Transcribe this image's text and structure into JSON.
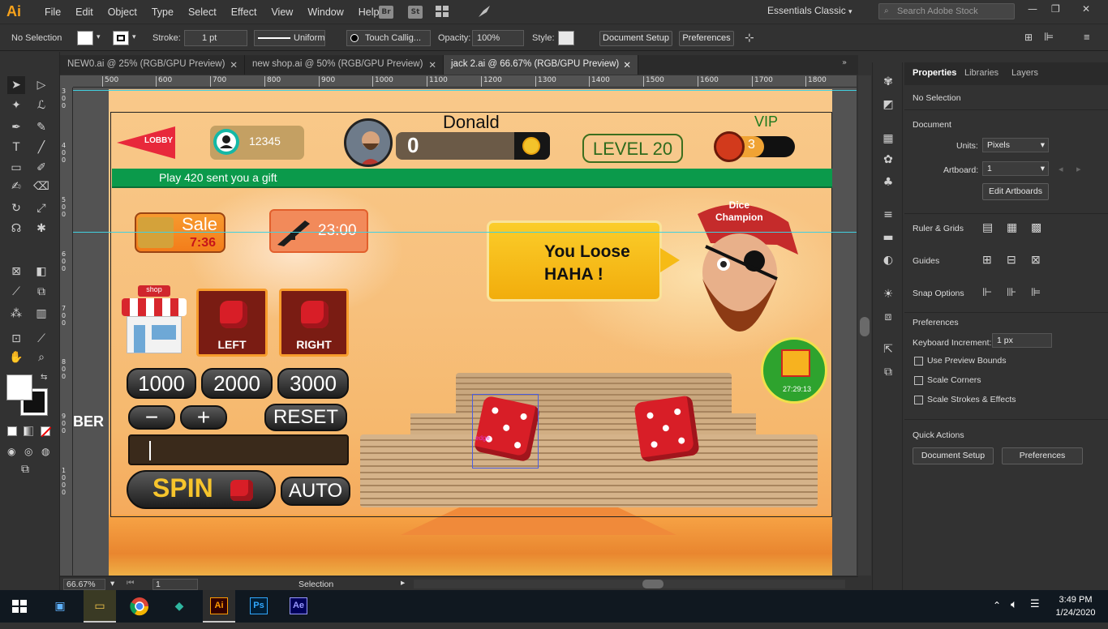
{
  "app": {
    "logo": "Ai",
    "menu": [
      "File",
      "Edit",
      "Object",
      "Type",
      "Select",
      "Effect",
      "View",
      "Window",
      "Help"
    ],
    "bridge_label": "Br",
    "stock_label": "St",
    "workspace": "Essentials Classic",
    "search_placeholder": "Search Adobe Stock"
  },
  "controlbar": {
    "selection_status": "No Selection",
    "stroke_label": "Stroke:",
    "stroke_value": "1 pt",
    "profile": "Uniform",
    "brush": "Touch Callig...",
    "opacity_label": "Opacity:",
    "opacity_value": "100%",
    "style_label": "Style:",
    "document_setup": "Document Setup",
    "preferences": "Preferences"
  },
  "tabs": [
    {
      "label": "NEW0.ai @ 25% (RGB/GPU Preview)",
      "active": false
    },
    {
      "label": "new shop.ai @ 50% (RGB/GPU Preview)",
      "active": false
    },
    {
      "label": "jack 2.ai @ 66.67% (RGB/GPU Preview)",
      "active": true
    }
  ],
  "hruler_marks": [
    "500",
    "600",
    "700",
    "800",
    "900",
    "1000",
    "1100",
    "1200",
    "1300",
    "1400",
    "1500",
    "1600",
    "1700",
    "1800"
  ],
  "vruler_marks": [
    "300",
    "400",
    "500",
    "600",
    "700",
    "800",
    "900",
    "1000"
  ],
  "artboard": {
    "lobby": "LOBBY",
    "player_id": "12345",
    "player_name": "Donald",
    "balance": "0",
    "level": "LEVEL 20",
    "vip_label": "VIP",
    "vip_count": "3",
    "gift_message": "Play 420 sent you a gift",
    "sale_label": "Sale",
    "sale_timer": "7:36",
    "weapon_timer": "23:00",
    "speech": [
      "You Loose",
      "HAHA !"
    ],
    "champion": [
      "Dice",
      "Champion"
    ],
    "gift_timer": "27:29:13",
    "shop_label": "shop",
    "left_label": "LEFT",
    "right_label": "RIGHT",
    "bets": [
      "1000",
      "2000",
      "3000"
    ],
    "minus": "−",
    "plus": "+",
    "reset": "RESET",
    "spin": "SPIN",
    "auto": "AUTO",
    "edge_label": "edge",
    "side_text": "BER"
  },
  "status": {
    "zoom": "66.67%",
    "artboard_num": "1",
    "mode": "Selection"
  },
  "properties": {
    "tabs": [
      "Properties",
      "Libraries",
      "Layers"
    ],
    "no_selection": "No Selection",
    "document_heading": "Document",
    "units_label": "Units:",
    "units_value": "Pixels",
    "artboard_label": "Artboard:",
    "artboard_value": "1",
    "edit_artboards": "Edit Artboards",
    "rulers_grids": "Ruler & Grids",
    "guides": "Guides",
    "snap_options": "Snap Options",
    "preferences_heading": "Preferences",
    "keyboard_increment_label": "Keyboard Increment:",
    "keyboard_increment_value": "1 px",
    "use_preview_bounds": "Use Preview Bounds",
    "scale_corners": "Scale Corners",
    "scale_strokes": "Scale Strokes & Effects",
    "quick_actions": "Quick Actions",
    "document_setup": "Document Setup",
    "preferences": "Preferences"
  },
  "taskbar": {
    "time": "3:49 PM",
    "date": "1/24/2020",
    "apps": [
      "Ai",
      "Ps",
      "Ae"
    ]
  },
  "colors": {
    "accent_ai": "#f7a21b",
    "gift_bar": "#0b9a4b",
    "dice_red": "#d81e27",
    "guide": "#41d0e0"
  }
}
